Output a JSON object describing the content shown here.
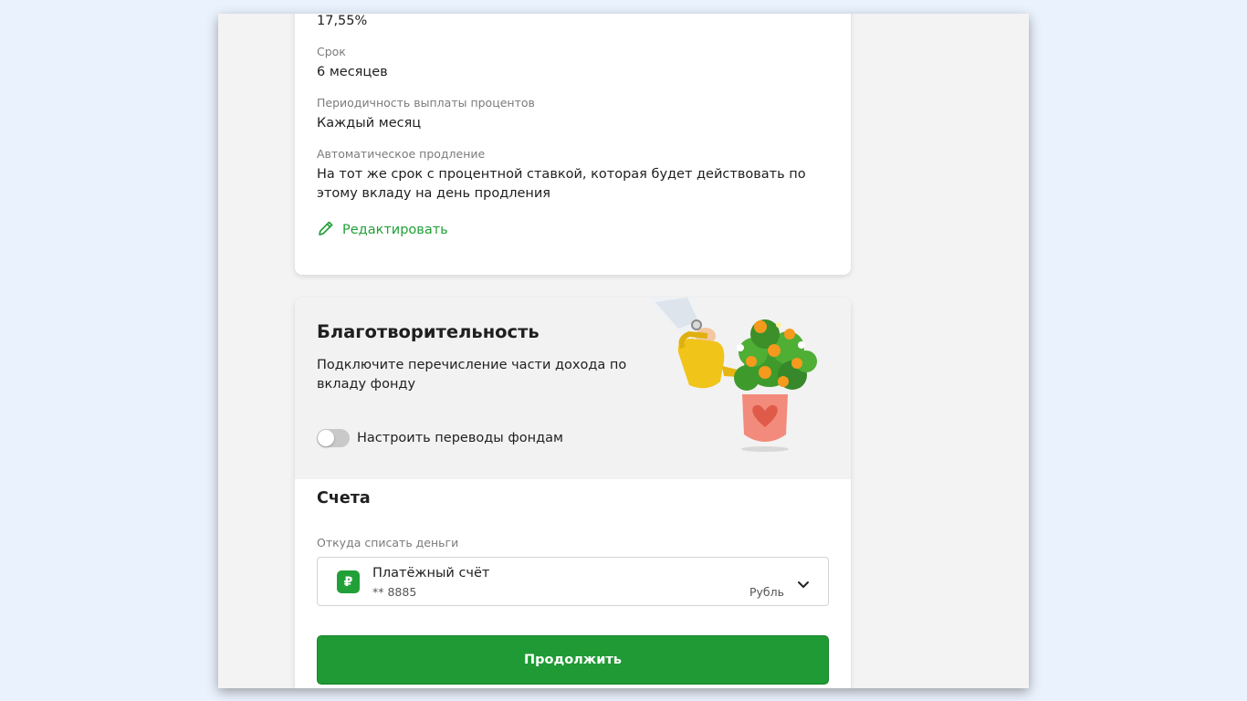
{
  "deposit": {
    "rate_value": "17,55%",
    "term_label": "Срок",
    "term_value": "6 месяцев",
    "payout_label": "Периодичность выплаты процентов",
    "payout_value": "Каждый месяц",
    "renewal_label": "Автоматическое продление",
    "renewal_value": "На тот же срок с процентной ставкой, которая будет действовать по этому вкладу на день продления",
    "edit_label": "Редактировать",
    "edit_icon": "pencil-icon"
  },
  "charity": {
    "title": "Благотворительность",
    "description": "Подключите перечисление части дохода по вкладу фонду",
    "toggle_label": "Настроить переводы фондам",
    "toggle_on": false
  },
  "accounts": {
    "title": "Счета",
    "from_label": "Откуда списать деньги",
    "selected": {
      "icon": "ruble-icon",
      "icon_text": "₽",
      "name": "Платёжный счёт",
      "number": "** 8885",
      "currency": "Рубль"
    }
  },
  "continue_label": "Продолжить",
  "colors": {
    "brand_green": "#21a038",
    "button_green": "#1f9a34",
    "page_bg": "#f3f3f3",
    "outer_bg": "#eaf2fd"
  }
}
